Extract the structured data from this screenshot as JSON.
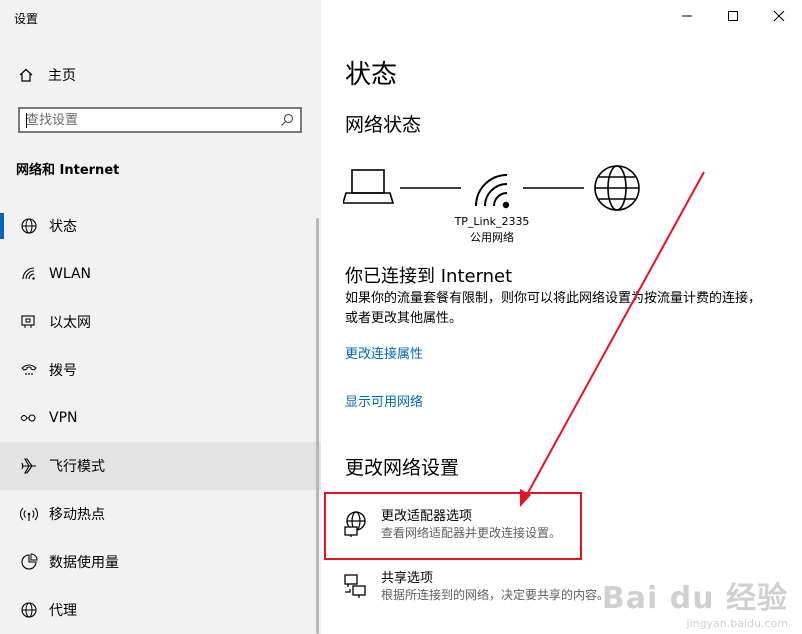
{
  "window": {
    "title": "设置"
  },
  "sidebar": {
    "home_label": "主页",
    "search_placeholder": "查找设置",
    "section_title": "网络和 Internet",
    "items": [
      {
        "label": "状态",
        "icon": "globe-icon"
      },
      {
        "label": "WLAN",
        "icon": "wifi-icon"
      },
      {
        "label": "以太网",
        "icon": "ethernet-icon"
      },
      {
        "label": "拨号",
        "icon": "dialup-icon"
      },
      {
        "label": "VPN",
        "icon": "vpn-icon"
      },
      {
        "label": "飞行模式",
        "icon": "airplane-icon"
      },
      {
        "label": "移动热点",
        "icon": "hotspot-icon"
      },
      {
        "label": "数据使用量",
        "icon": "data-usage-icon"
      },
      {
        "label": "代理",
        "icon": "globe-icon"
      }
    ],
    "selected_index": 0,
    "hover_index": 5
  },
  "main": {
    "page_title": "状态",
    "network_status_heading": "网络状态",
    "network": {
      "ssid": "TP_Link_2335",
      "type": "公用网络"
    },
    "connected_text": "你已连接到 Internet",
    "description": "如果你的流量套餐有限制，则你可以将此网络设置为按流量计费的连接，或者更改其他属性。",
    "link_change_properties": "更改连接属性",
    "link_show_networks": "显示可用网络",
    "change_settings_heading": "更改网络设置",
    "options": [
      {
        "title": "更改适配器选项",
        "subtitle": "查看网络适配器并更改连接设置。",
        "icon": "adapter-icon"
      },
      {
        "title": "共享选项",
        "subtitle": "根据所连接到的网络，决定要共享的内容。",
        "icon": "sharing-icon"
      }
    ]
  },
  "annotation": {
    "color": "#e81123"
  },
  "watermark": {
    "brand": "Bai du 经验",
    "url": "jingyan.baidu.com"
  },
  "colors": {
    "accent": "#0067c0",
    "sidebar_bg": "#f2f2f2",
    "hover_bg": "#e3e3e3"
  }
}
